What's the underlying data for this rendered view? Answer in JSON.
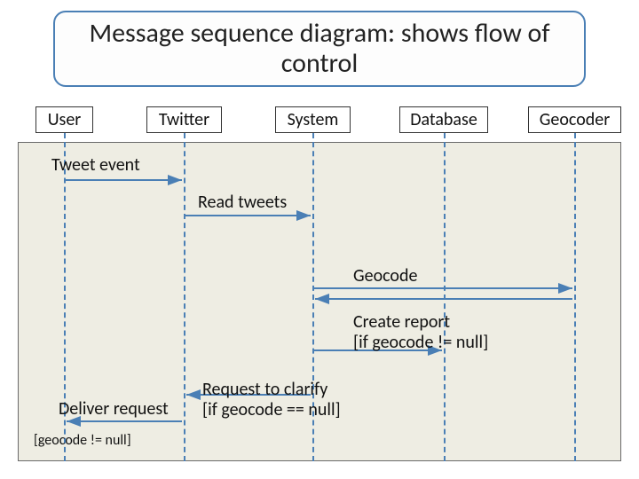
{
  "title": "Message sequence diagram: shows flow of control",
  "actors": {
    "user": "User",
    "twitter": "Twitter",
    "system": "System",
    "database": "Database",
    "geocoder": "Geocoder"
  },
  "messages": {
    "tweet_event": "Tweet event",
    "read_tweets": "Read tweets",
    "geocode": "Geocode",
    "create_report": "Create report\n[if geocode != null]",
    "request_clarify": "Request to clarify\n[if geocode == null]",
    "deliver_request": "Deliver request",
    "deliver_guard": "[geocode != null]"
  },
  "colors": {
    "accent": "#4a7fb5",
    "canvas_bg": "#eeede3"
  }
}
